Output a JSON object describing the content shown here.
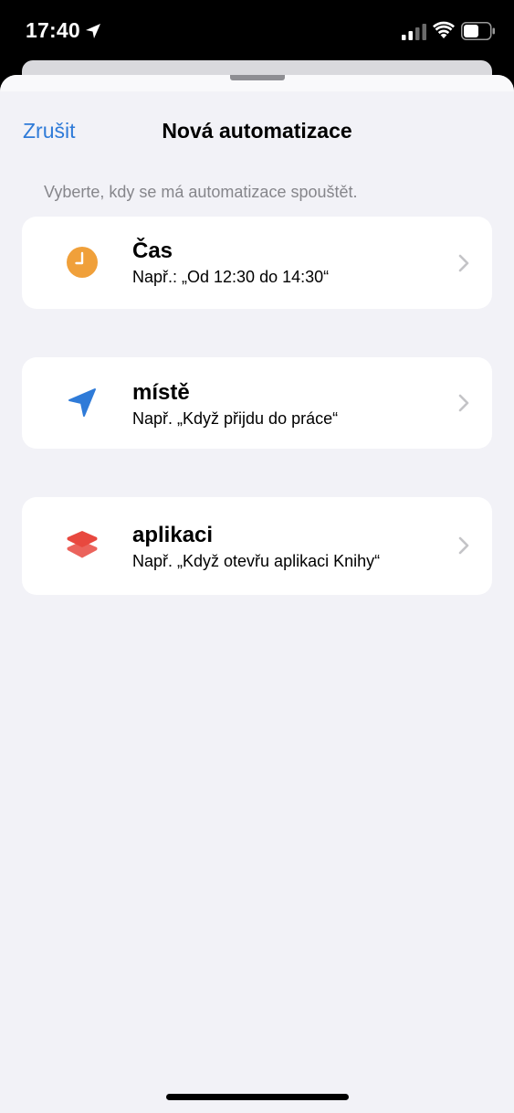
{
  "status_bar": {
    "time": "17:40"
  },
  "nav": {
    "cancel_label": "Zrušit",
    "title": "Nová automatizace"
  },
  "hint": "Vyberte, kdy se má automatizace spouštět.",
  "options": [
    {
      "title": "Čas",
      "subtitle": "Např.: „Od 12:30 do 14:30“",
      "icon": "clock-icon",
      "color": "#f0a03a"
    },
    {
      "title": "místě",
      "subtitle": "Např. „Když přijdu do práce“",
      "icon": "location-arrow-icon",
      "color": "#2f7bd8"
    },
    {
      "title": "aplikaci",
      "subtitle": "Např. „Když otevřu aplikaci Knihy“",
      "icon": "app-layers-icon",
      "color": "#e8483f"
    }
  ]
}
